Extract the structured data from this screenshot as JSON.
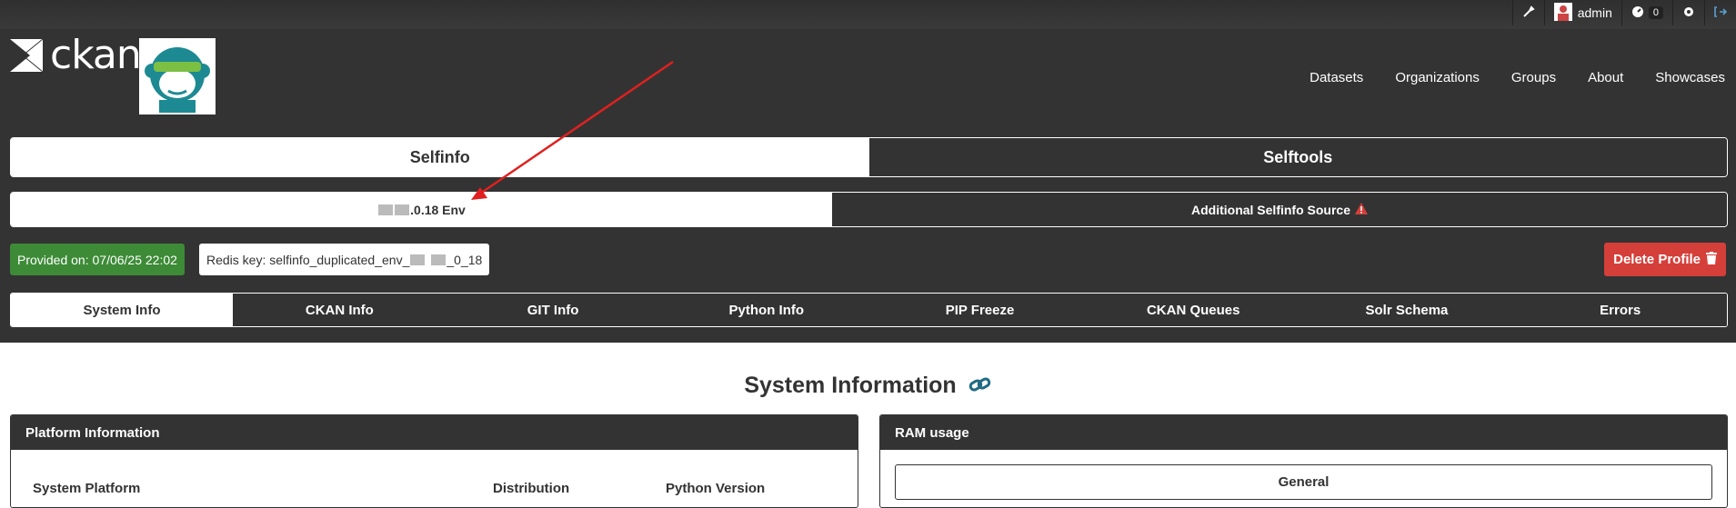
{
  "account": {
    "user": "admin",
    "notifications": "0",
    "icons": [
      "wrench-icon",
      "avatar",
      "dashboard-icon",
      "gear-icon",
      "logout-icon"
    ]
  },
  "site": {
    "logo_text": "ckan"
  },
  "nav": [
    "Datasets",
    "Organizations",
    "Groups",
    "About",
    "Showcases"
  ],
  "main_switch": {
    "selfinfo": "Selfinfo",
    "selftools": "Selftools"
  },
  "env_switch": {
    "env_label": ".0.18 Env",
    "additional": "Additional Selfinfo Source"
  },
  "status": {
    "provided": "Provided on: 07/06/25 22:02",
    "redis_prefix": "Redis key: selfinfo_duplicated_env_",
    "redis_suffix": "_0_18",
    "delete": "Delete Profile"
  },
  "tabs": [
    "System Info",
    "CKAN Info",
    "GIT Info",
    "Python Info",
    "PIP Freeze",
    "CKAN Queues",
    "Solr Schema",
    "Errors"
  ],
  "section": {
    "title": "System Information"
  },
  "platform_panel": {
    "title": "Platform Information",
    "columns": [
      "System Platform",
      "Distribution",
      "Python Version"
    ]
  },
  "ram_panel": {
    "title": "RAM usage",
    "general": "General"
  },
  "colors": {
    "header": "#333333",
    "green": "#3d8b37",
    "red": "#d53f3a",
    "link": "#206b82",
    "arrow": "#e02020"
  }
}
